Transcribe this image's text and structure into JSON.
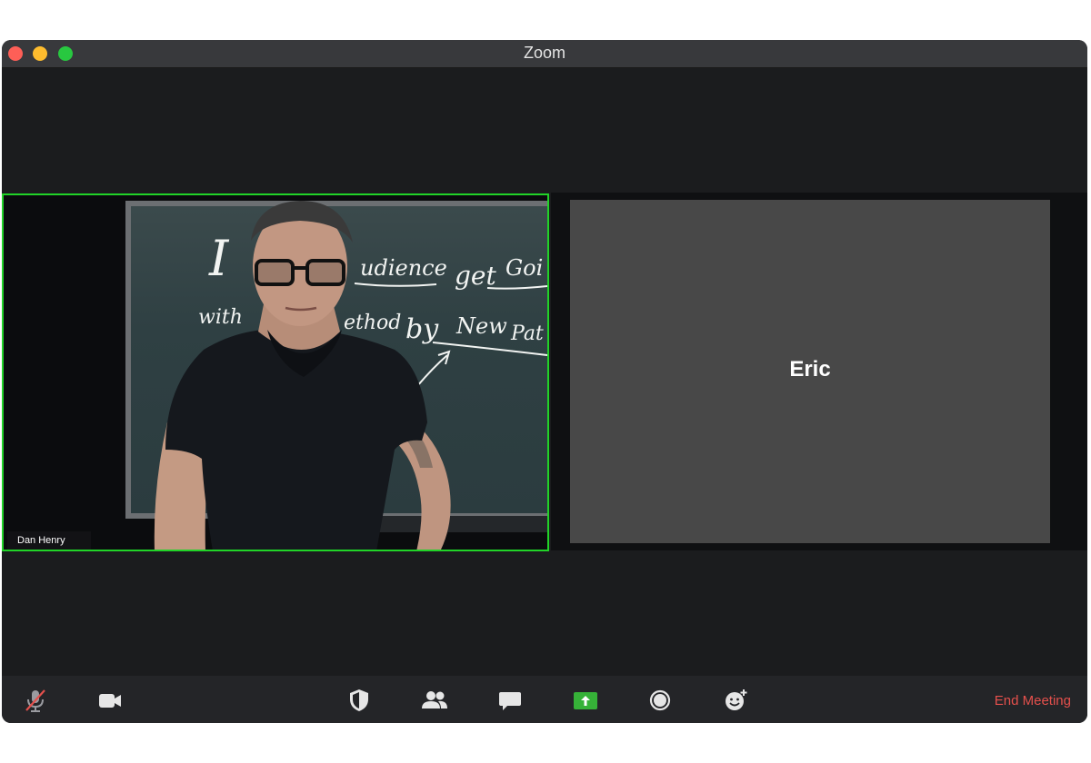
{
  "window": {
    "title": "Zoom"
  },
  "participants": [
    {
      "name": "Dan Henry",
      "video": true,
      "active_speaker": true
    },
    {
      "name": "Eric",
      "video": false,
      "active_speaker": false
    }
  ],
  "whiteboard": {
    "line1a": "I",
    "line1b": "udience",
    "line1c": "get",
    "line1d": "Goi",
    "line2a": "with",
    "line2b": "ethod",
    "line2c": "by",
    "line2d": "New",
    "line2e": "Pat"
  },
  "toolbar": {
    "end_meeting_label": "End Meeting",
    "icons": [
      "mic-muted-icon",
      "video-camera-icon",
      "security-shield-icon",
      "participants-icon",
      "chat-icon",
      "share-screen-icon",
      "record-icon",
      "reactions-icon"
    ]
  },
  "colors": {
    "active_speaker_border": "#21d328",
    "end_meeting": "#e4504c",
    "share_screen": "#36b238"
  }
}
